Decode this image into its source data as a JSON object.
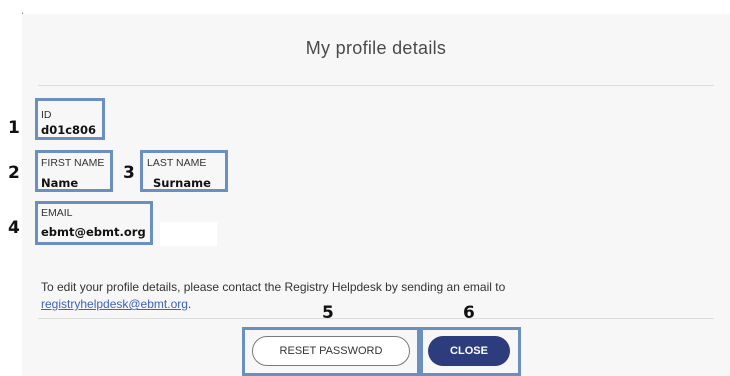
{
  "modal": {
    "title": "My profile details"
  },
  "fields": {
    "id": {
      "label": "ID",
      "value": "d01c806"
    },
    "first_name": {
      "label": "FIRST NAME",
      "value": "Name"
    },
    "last_name": {
      "label": "LAST NAME",
      "value": "Surname"
    },
    "email": {
      "label": "EMAIL",
      "value": "ebmt@ebmt.org"
    }
  },
  "callouts": [
    "1",
    "2",
    "3",
    "4",
    "5",
    "6"
  ],
  "help": {
    "text": "To edit your profile details, please contact the Registry Helpdesk by sending an email to",
    "link": "registryhelpdesk@ebmt.org",
    "suffix": "."
  },
  "buttons": {
    "reset_password": "RESET PASSWORD",
    "close": "CLOSE"
  },
  "colors": {
    "highlight_border": "#6b8fbf",
    "close_button": "#2c3c7d",
    "link": "#3f62b8"
  }
}
